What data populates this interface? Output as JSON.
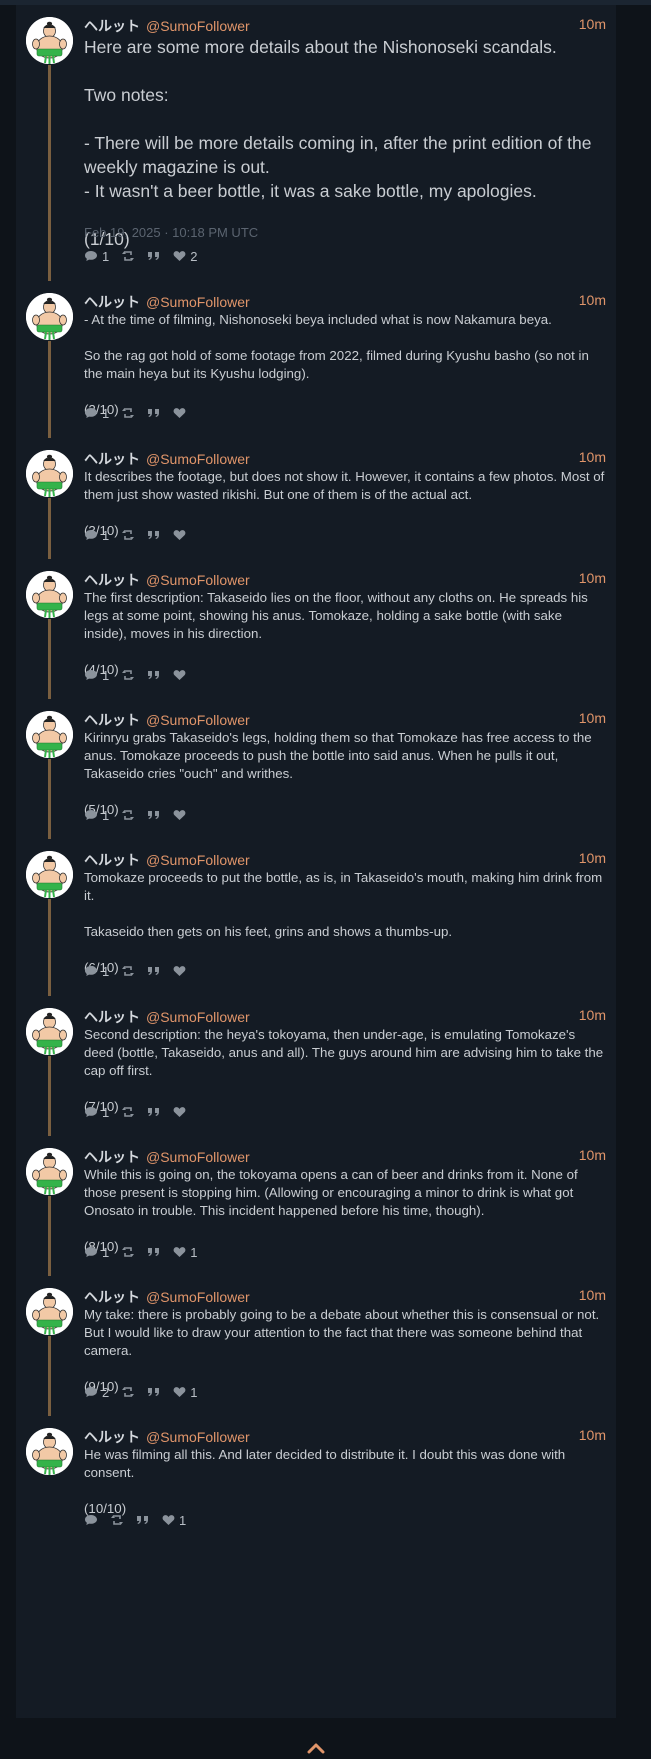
{
  "colors": {
    "background": "#0e1319",
    "card": "#141b24",
    "accent": "#e0956a",
    "thread_line": "#7a5f40"
  },
  "user": {
    "display_name": "ヘルット",
    "handle": "@SumoFollower"
  },
  "icons": {
    "reply": "comment-icon",
    "repost": "repost-icon",
    "quote": "quote-icon",
    "like": "heart-icon",
    "scroll": "chevron-up-icon"
  },
  "posts": [
    {
      "time": "10m",
      "paragraphs": [
        "Here are some more details about the Nishonoseki scandals.",
        "Two notes:",
        "- There will be more details coming in, after the print edition of the weekly magazine is out.\n- It wasn't a beer bottle, it was a sake bottle, my apologies.",
        "(1/10)"
      ],
      "date": "Feb 19, 2025 · 10:18 PM UTC",
      "replies": "1",
      "likes": "2"
    },
    {
      "time": "10m",
      "paragraphs": [
        "- At the time of filming, Nishonoseki beya included what is now Nakamura beya.",
        "So the rag got hold of some footage from 2022, filmed during Kyushu basho (so not in the main heya but its Kyushu lodging).",
        "(2/10)"
      ],
      "replies": "1",
      "likes": ""
    },
    {
      "time": "10m",
      "paragraphs": [
        "It describes the footage, but does not show it. However, it contains a few photos. Most of them just show wasted rikishi. But one of them is of the actual act.",
        "(3/10)"
      ],
      "replies": "1",
      "likes": ""
    },
    {
      "time": "10m",
      "paragraphs": [
        "The first description: Takaseido lies on the floor, without any cloths on. He spreads his legs at some point, showing his anus. Tomokaze, holding a sake bottle (with sake inside), moves in his direction.",
        "(4/10)"
      ],
      "replies": "1",
      "likes": ""
    },
    {
      "time": "10m",
      "paragraphs": [
        "Kirinryu grabs Takaseido's legs, holding them so that Tomokaze has free access to the anus. Tomokaze proceeds to push the bottle into said anus. When he pulls it out, Takaseido cries \"ouch\" and writhes.",
        "(5/10)"
      ],
      "replies": "1",
      "likes": ""
    },
    {
      "time": "10m",
      "paragraphs": [
        "Tomokaze proceeds to put the bottle, as is, in Takaseido's mouth, making him drink from it.",
        "Takaseido then gets on his feet, grins and shows a thumbs-up.",
        "(6/10)"
      ],
      "replies": "1",
      "likes": ""
    },
    {
      "time": "10m",
      "paragraphs": [
        "Second description: the heya's tokoyama, then under-age, is emulating Tomokaze's deed (bottle, Takaseido, anus and all). The guys around him are advising him to take the cap off first.",
        "(7/10)"
      ],
      "replies": "1",
      "likes": ""
    },
    {
      "time": "10m",
      "paragraphs": [
        "While this is going on, the tokoyama opens a can of beer and drinks from it. None of those present is stopping him. (Allowing or encouraging a minor to drink is what got Onosato in trouble. This incident happened before his time, though).",
        "(8/10)"
      ],
      "replies": "1",
      "likes": "1"
    },
    {
      "time": "10m",
      "paragraphs": [
        "My take: there is probably going to be a debate about whether this is consensual or not. But I would like to draw your attention to the fact that there was someone behind that camera.",
        "(9/10)"
      ],
      "replies": "2",
      "likes": "1"
    },
    {
      "time": "10m",
      "paragraphs": [
        "He was filming all this. And later decided to distribute it. I doubt this was done with consent.",
        "(10/10)"
      ],
      "replies": "",
      "likes": "1"
    }
  ]
}
